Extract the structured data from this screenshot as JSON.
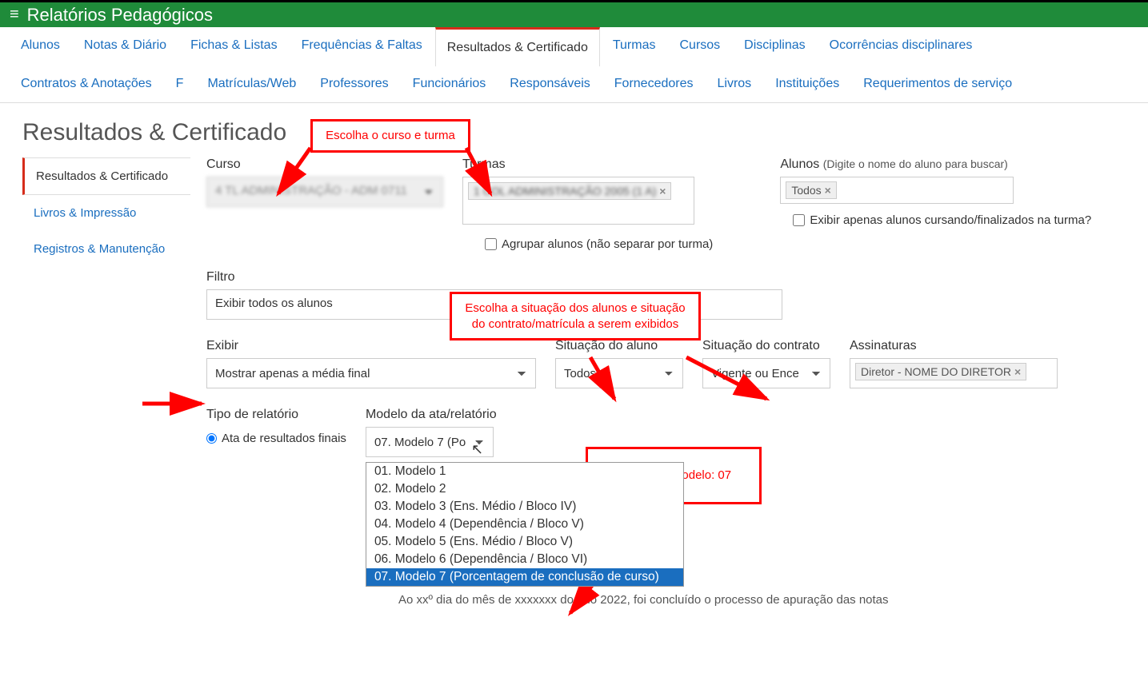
{
  "topbar": {
    "title": "Relatórios Pedagógicos"
  },
  "nav": {
    "row1": [
      "Alunos",
      "Notas & Diário",
      "Fichas & Listas",
      "Frequências & Faltas",
      "Resultados & Certificado",
      "Turmas",
      "Cursos",
      "Disciplinas",
      "Ocorrências disciplinares",
      "Contratos & Anotações",
      "F"
    ],
    "row2": [
      "Matrículas/Web",
      "Professores",
      "Funcionários",
      "Responsáveis",
      "Fornecedores",
      "Livros",
      "Instituições",
      "Requerimentos de serviço"
    ],
    "active_index_row1": 4
  },
  "page": {
    "heading": "Resultados & Certificado"
  },
  "sidebar": {
    "items": [
      "Resultados & Certificado",
      "Livros & Impressão",
      "Registros & Manutenção"
    ],
    "active_index": 0
  },
  "form": {
    "curso": {
      "label": "Curso",
      "value": "4 TL ADMINISTRAÇÃO - ADM 0711"
    },
    "turmas": {
      "label": "Turmas",
      "tag": "1 COL ADMINISTRAÇÃO 2005 (1 A)"
    },
    "agrupar": {
      "label": "Agrupar alunos (não separar por turma)"
    },
    "alunos": {
      "label": "Alunos",
      "hint": "(Digite o nome do aluno para buscar)",
      "tag": "Todos"
    },
    "exibir_apenas": {
      "label": "Exibir apenas alunos cursando/finalizados na turma?"
    },
    "filtro": {
      "label": "Filtro",
      "value": "Exibir todos os alunos"
    },
    "exibir": {
      "label": "Exibir",
      "value": "Mostrar apenas a média final"
    },
    "situacao_aluno": {
      "label": "Situação do aluno",
      "value": "Todos"
    },
    "situacao_contrato": {
      "label": "Situação do contrato",
      "value": "Vigente ou Ence"
    },
    "assinaturas": {
      "label": "Assinaturas",
      "tag": "Diretor - NOME DO DIRETOR"
    },
    "tipo_relatorio": {
      "label": "Tipo de relatório",
      "option": "Ata de resultados finais"
    },
    "modelo": {
      "label": "Modelo da ata/relatório",
      "value": "07. Modelo 7 (Po",
      "options": [
        "01. Modelo 1",
        "02. Modelo 2",
        "03. Modelo 3 (Ens. Médio / Bloco IV)",
        "04. Modelo 4 (Dependência / Bloco V)",
        "05. Modelo 5 (Ens. Médio / Bloco V)",
        "06. Modelo 6 (Dependência / Bloco VI)",
        "07. Modelo 7 (Porcentagem de conclusão de curso)"
      ],
      "selected_index": 6
    }
  },
  "callouts": {
    "c1": "Escolha o curso e turma",
    "c2": "Escolha a situação dos alunos e situação do contrato/matrícula a serem exibidos",
    "c3": "Escolha o modelo: 07"
  },
  "footer_text": "Ao xxº dia do mês de xxxxxxx do ano 2022, foi concluído o processo de apuração das notas"
}
